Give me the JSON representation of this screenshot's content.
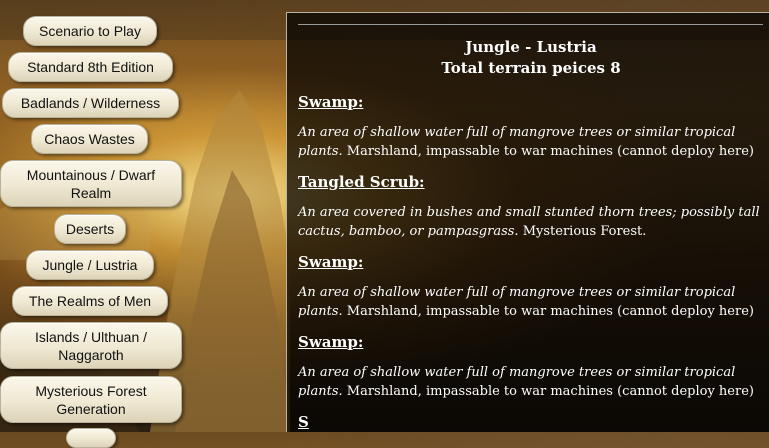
{
  "nav": {
    "items": [
      {
        "label": "Scenario to Play"
      },
      {
        "label": "Standard 8th Edition"
      },
      {
        "label": "Badlands / Wilderness"
      },
      {
        "label": "Chaos Wastes"
      },
      {
        "label": "Mountainous / Dwarf Realm"
      },
      {
        "label": "Deserts"
      },
      {
        "label": "Jungle / Lustria"
      },
      {
        "label": "The Realms of Men"
      },
      {
        "label": "Islands / Ulthuan / Naggaroth"
      },
      {
        "label": "Mysterious Forest Generation"
      }
    ]
  },
  "content": {
    "heading": "Jungle - Lustria",
    "subheading": "Total terrain peices 8",
    "terrains": [
      {
        "name": "Swamp:",
        "desc_italic": "An area of shallow water full of mangrove trees or similar tropical plants.",
        "desc_plain": "Marshland, impassable to war machines (cannot deploy here)"
      },
      {
        "name": "Tangled Scrub:",
        "desc_italic": "An area covered in bushes and small stunted thorn trees; possibly tall cactus, bamboo, or pampasgrass.",
        "desc_plain": "Mysterious Forest."
      },
      {
        "name": "Swamp:",
        "desc_italic": "An area of shallow water full of mangrove trees or similar tropical plants.",
        "desc_plain": "Marshland, impassable to war machines (cannot deploy here)"
      },
      {
        "name": "Swamp:",
        "desc_italic": "An area of shallow water full of mangrove trees or similar tropical plants.",
        "desc_plain": "Marshland, impassable to war machines (cannot deploy here)"
      },
      {
        "name": "S",
        "desc_italic": "",
        "desc_plain": ""
      }
    ]
  }
}
